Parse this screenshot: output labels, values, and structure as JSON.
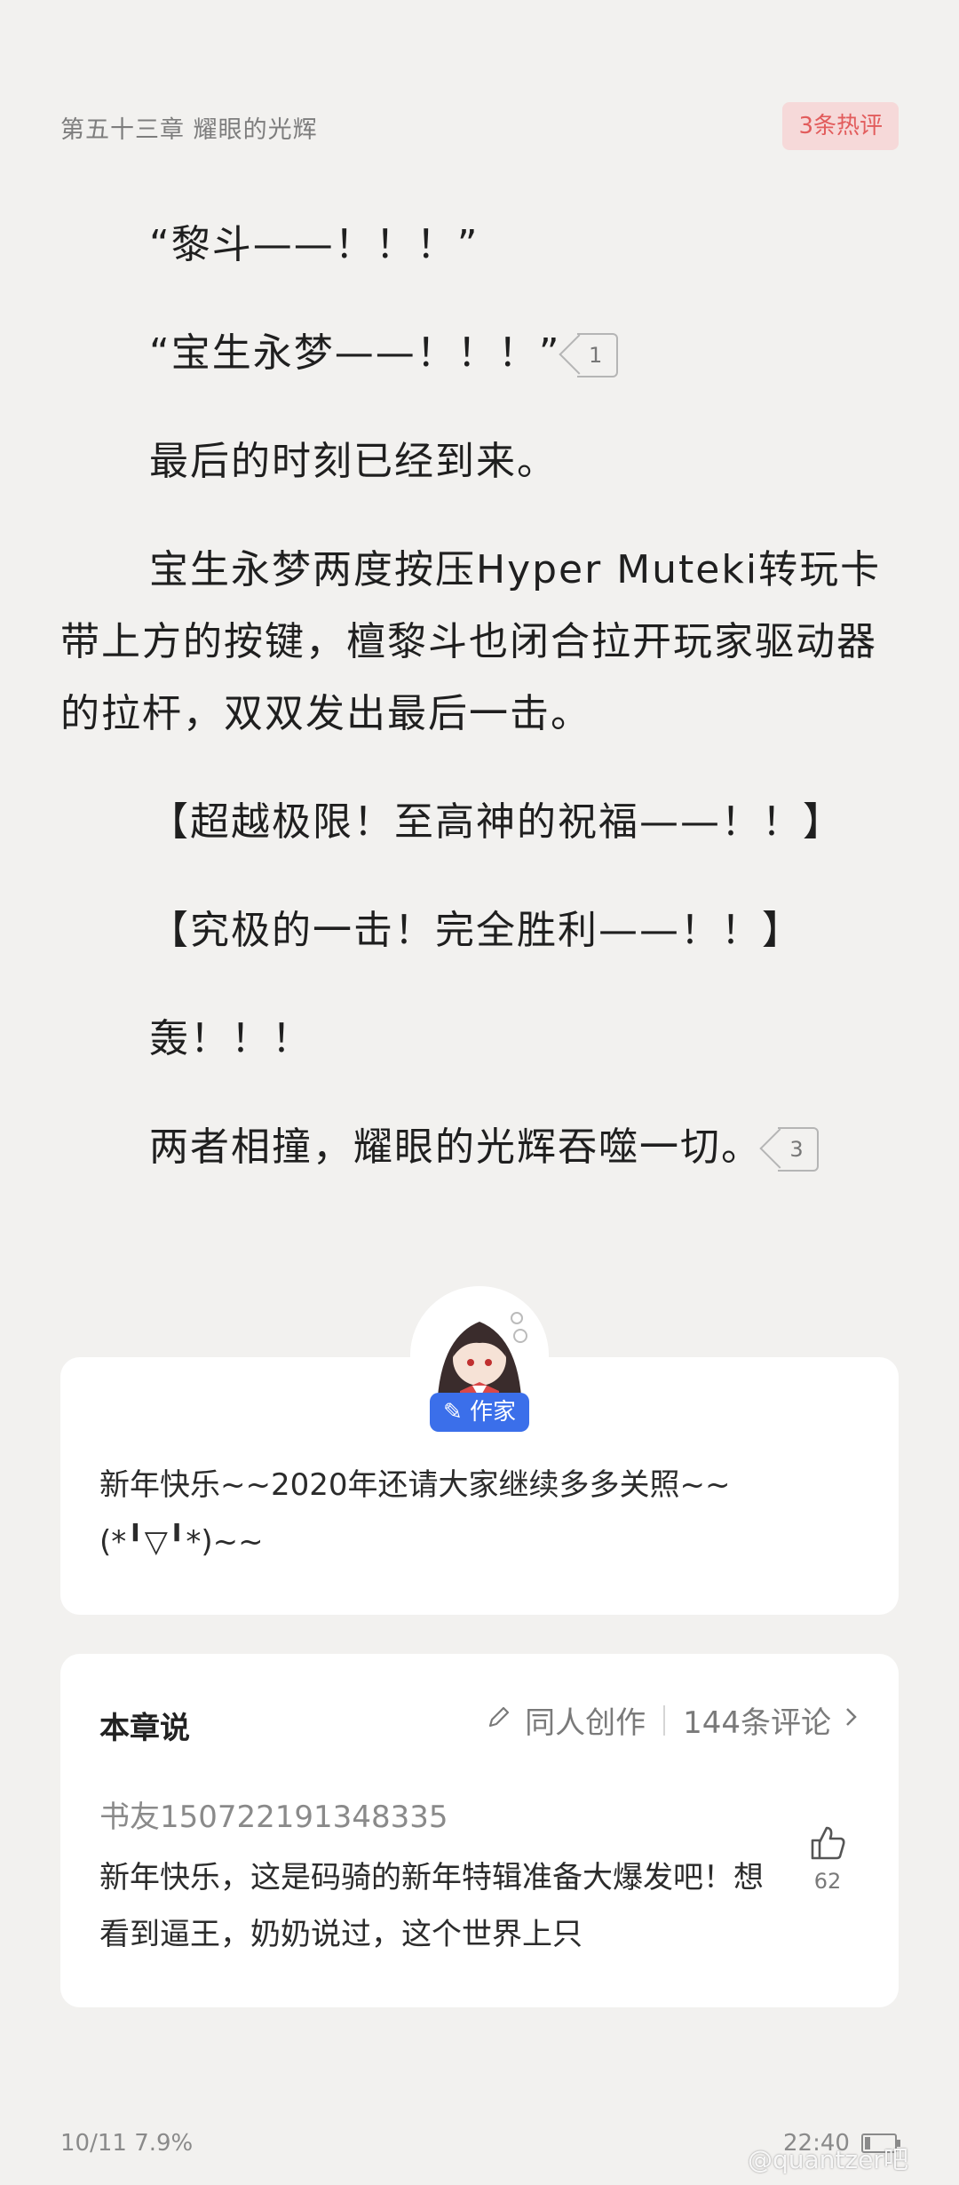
{
  "header": {
    "chapter_title": "第五十三章 耀眼的光辉",
    "hot_comments": "3条热评"
  },
  "content": {
    "paragraphs": [
      {
        "text": "“黎斗——！！！”"
      },
      {
        "text": "“宝生永梦——！！！”",
        "comment_count": "1"
      },
      {
        "text": "最后的时刻已经到来。"
      },
      {
        "text": "宝生永梦两度按压Hyper Muteki转玩卡带上方的按键，檀黎斗也闭合拉开玩家驱动器的拉杆，双双发出最后一击。"
      },
      {
        "text": "【超越极限！至高神的祝福——！！】"
      },
      {
        "text": "【究极的一击！完全胜利——！！】"
      },
      {
        "text": "轰！！！"
      },
      {
        "text": "两者相撞，耀眼的光辉吞噬一切。",
        "comment_count": "3"
      }
    ]
  },
  "author_card": {
    "badge": "作家",
    "message": "新年快乐~~2020年还请大家继续多多关照~~(*╹▽╹*)~~"
  },
  "chapter_card": {
    "title": "本章说",
    "fan_creation": "同人创作",
    "comment_count": "144条评论",
    "commenter": "书友150722191348335",
    "comment": "新年快乐，这是码骑的新年特辑准备大爆发吧！想看到逼王，奶奶说过，这个世界上只",
    "likes": "62"
  },
  "footer": {
    "page": "10/11",
    "progress": "7.9%",
    "time": "22:40",
    "watermark": "@quantzer吧"
  },
  "colors": {
    "background": "#f2f1ef",
    "accent_red": "#e25c5c",
    "author_blue": "#3b6fea"
  }
}
